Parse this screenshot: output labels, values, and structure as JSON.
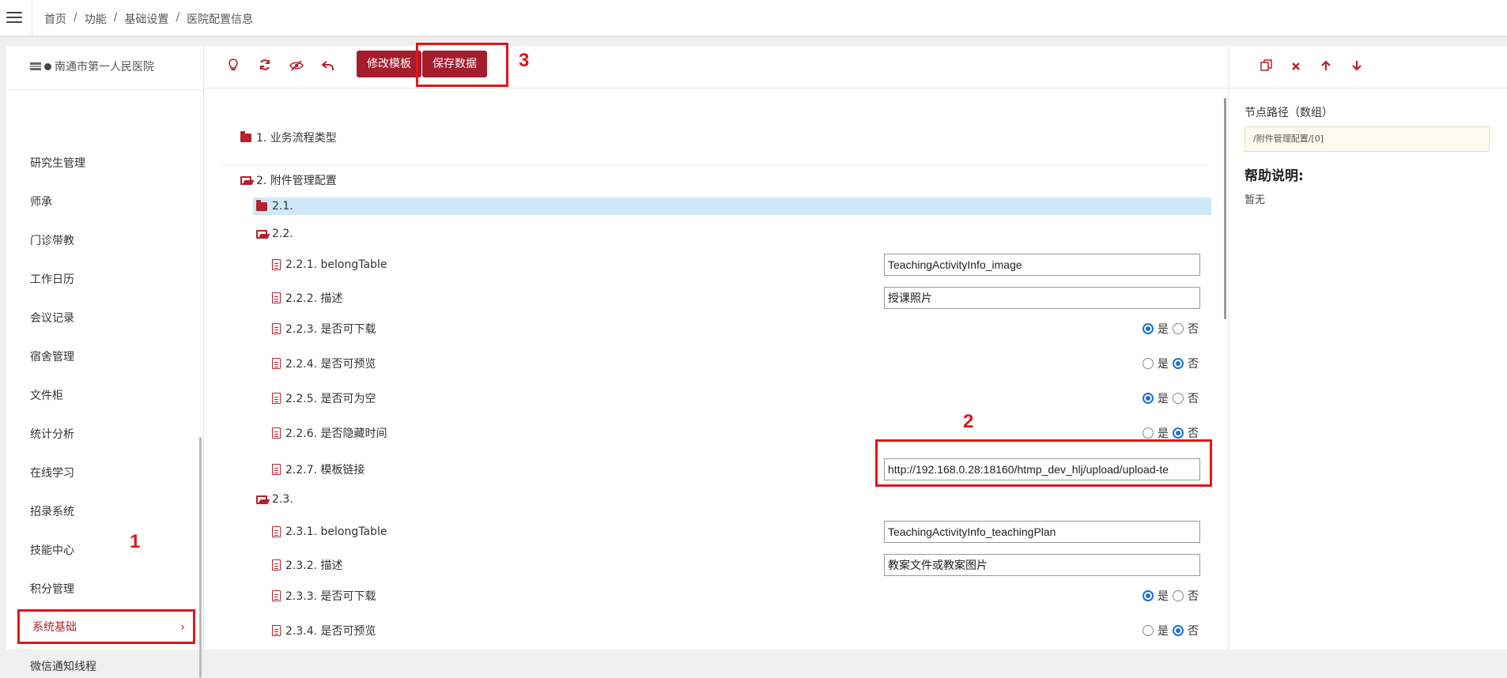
{
  "breadcrumb": [
    "首页",
    "功能",
    "基础设置",
    "医院配置信息"
  ],
  "breadcrumb_sep": "/",
  "sidebar": {
    "hospital": "南通市第一人民医院",
    "items": [
      {
        "label": "研究生管理"
      },
      {
        "label": "师承"
      },
      {
        "label": "门诊带教"
      },
      {
        "label": "工作日历"
      },
      {
        "label": "会议记录"
      },
      {
        "label": "宿舍管理"
      },
      {
        "label": "文件柜"
      },
      {
        "label": "统计分析"
      },
      {
        "label": "在线学习"
      },
      {
        "label": "招录系统"
      },
      {
        "label": "技能中心"
      },
      {
        "label": "积分管理"
      },
      {
        "label": "系统基础",
        "active": true
      },
      {
        "label": "微信通知线程"
      }
    ],
    "active_chevron": "›"
  },
  "toolbar": {
    "icons": [
      "bulb-icon",
      "refresh-icon",
      "eye-slash-icon",
      "undo-icon"
    ],
    "edit_template": "修改模板",
    "save_data": "保存数据"
  },
  "annotations": {
    "a1": "1",
    "a2": "2",
    "a3": "3"
  },
  "tree": {
    "n1": "1. 业务流程类型",
    "n2": "2. 附件管理配置",
    "n21": "2.1.",
    "n22": "2.2.",
    "n221": {
      "label": "2.2.1. belongTable",
      "value": "TeachingActivityInfo_image"
    },
    "n222": {
      "label": "2.2.2. 描述",
      "value": "授课照片"
    },
    "n223": {
      "label": "2.2.3. 是否可下载",
      "selected": "是"
    },
    "n224": {
      "label": "2.2.4. 是否可预览",
      "selected": "否"
    },
    "n225": {
      "label": "2.2.5. 是否可为空",
      "selected": "是"
    },
    "n226": {
      "label": "2.2.6. 是否隐藏时间",
      "selected": "否"
    },
    "n227": {
      "label": "2.2.7. 模板链接",
      "value": "http://192.168.0.28:18160/htmp_dev_hlj/upload/upload-te"
    },
    "n23": "2.3.",
    "n231": {
      "label": "2.3.1. belongTable",
      "value": "TeachingActivityInfo_teachingPlan"
    },
    "n232": {
      "label": "2.3.2. 描述",
      "value": "教案文件或教案图片"
    },
    "n233": {
      "label": "2.3.3. 是否可下载",
      "selected": "是"
    },
    "n234": {
      "label": "2.3.4. 是否可预览",
      "selected": "否"
    }
  },
  "radio_labels": {
    "yes": "是",
    "no": "否"
  },
  "right_panel": {
    "icons": [
      "copy-icon",
      "delete-icon",
      "arrow-up-icon",
      "arrow-down-icon"
    ],
    "path_label": "节点路径（数组）",
    "path_value": "/附件管理配置/[0]",
    "help_title": "帮助说明:",
    "help_text": "暂无"
  },
  "colors": {
    "accent": "#a51d2d",
    "annotation": "#e0161a",
    "selected_row": "#cfe8f7",
    "radio_on": "#1a6fd6"
  }
}
